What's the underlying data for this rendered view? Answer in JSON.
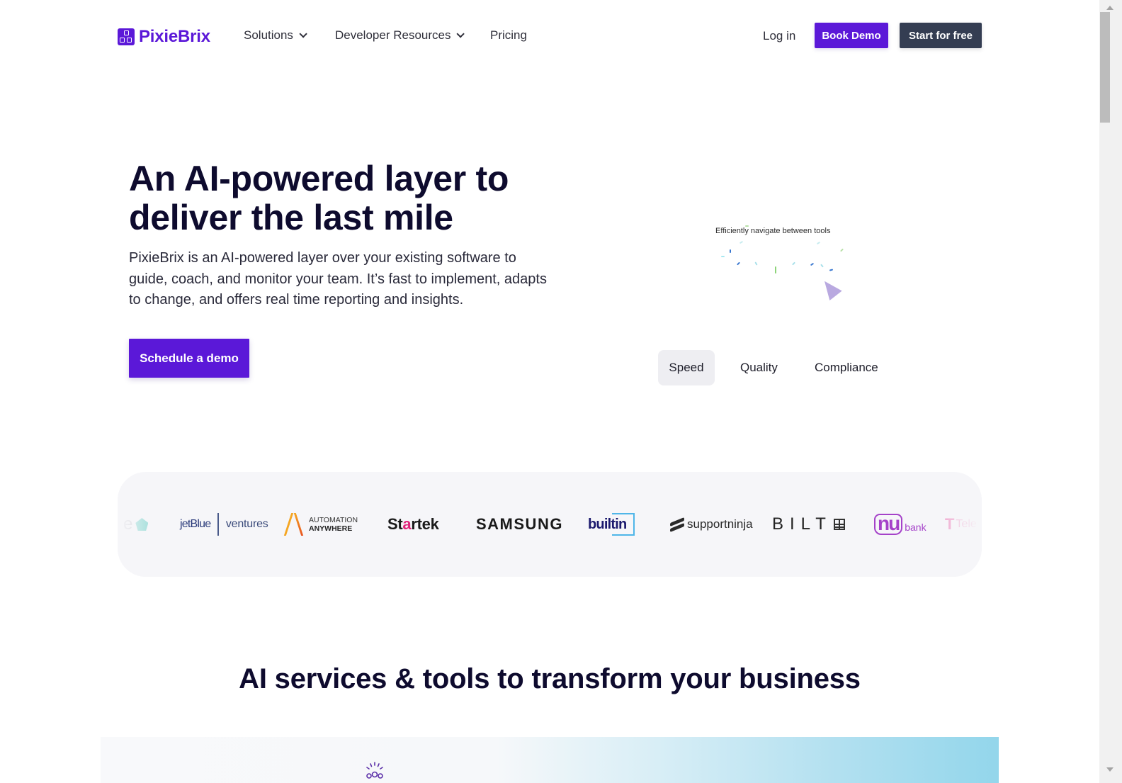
{
  "nav": {
    "brand": "PixieBrix",
    "links": [
      {
        "label": "Solutions",
        "has_dropdown": true
      },
      {
        "label": "Developer Resources",
        "has_dropdown": true
      },
      {
        "label": "Pricing",
        "has_dropdown": false
      }
    ],
    "login_label": "Log in",
    "book_demo_label": "Book Demo",
    "start_free_label": "Start for free"
  },
  "hero": {
    "title": "An AI-powered layer to deliver the last mile",
    "subtitle": "PixieBrix is an AI-powered layer over your existing software to guide, coach, and monitor your team. It’s fast to implement, adapts to change, and offers real time reporting and insights.",
    "cta_label": "Schedule a demo",
    "animation_caption": "Efficiently navigate between tools",
    "tabs": [
      {
        "label": "Speed",
        "active": true
      },
      {
        "label": "Quality",
        "active": false
      },
      {
        "label": "Compliance",
        "active": false
      }
    ]
  },
  "logos": {
    "partial_left": "e",
    "jetblue": "jetBlue",
    "jetblue_suffix": "ventures",
    "automation_line1": "AUTOMATION",
    "automation_line2": "ANYWHERE",
    "startek_a": "St",
    "startek_b": "a",
    "startek_c": "rtek",
    "samsung": "SAMSUNG",
    "builtin": "builtin",
    "supportninja": "supportninja",
    "bilt": "BILT",
    "nubank_nu": "nu",
    "nubank_bank": "bank",
    "tele_mark": "T",
    "tele_partial": "Tele"
  },
  "services": {
    "title": "AI services & tools to transform your business"
  },
  "colors": {
    "brand_purple": "#5b18d8",
    "dark_button": "#343d52",
    "heading": "#0e0b2e"
  }
}
